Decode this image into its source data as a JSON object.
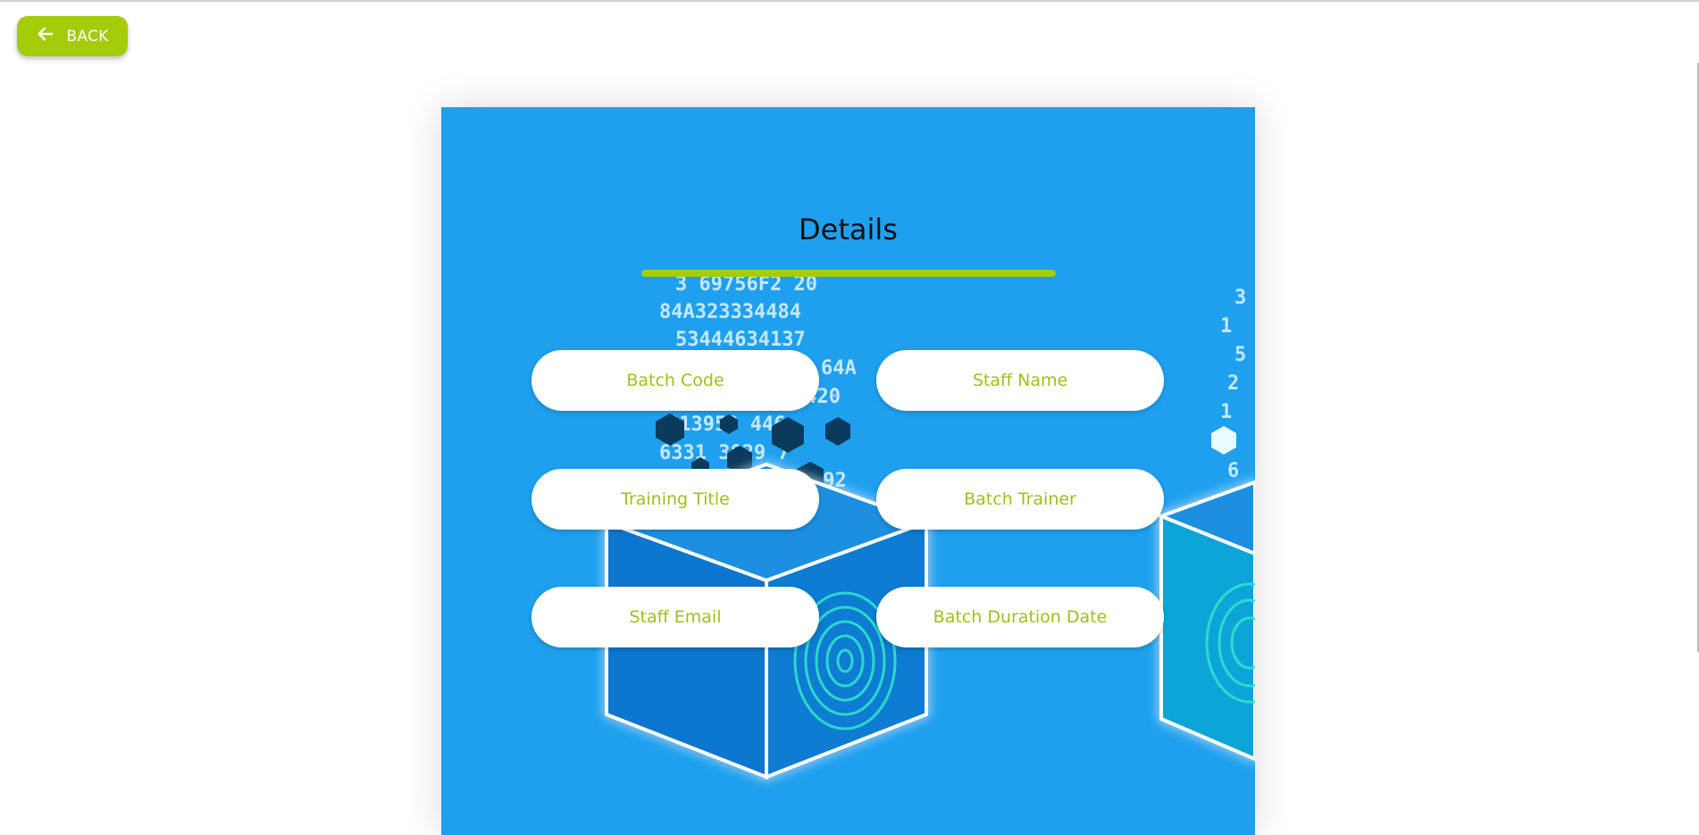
{
  "nav": {
    "back_label": "BACK",
    "back_icon": "arrow-left-icon"
  },
  "panel": {
    "title": "Details",
    "background_art": {
      "description_icons": [
        "hexagon",
        "fingerprint",
        "cube"
      ],
      "digit_rows": [
        "3 69756F2 20",
        "84A323334484",
        "53444634137",
        "64A",
        "4420",
        "013953 446",
        "6331 3829 7",
        "392"
      ],
      "right_digits": [
        "3",
        "1",
        "5",
        "2",
        "1",
        "6"
      ]
    },
    "fields": [
      {
        "id": "batch-code",
        "label": "Batch Code"
      },
      {
        "id": "staff-name",
        "label": "Staff Name"
      },
      {
        "id": "training-title",
        "label": "Training Title"
      },
      {
        "id": "batch-trainer",
        "label": "Batch Trainer"
      },
      {
        "id": "staff-email",
        "label": "Staff Email"
      },
      {
        "id": "batch-duration-date",
        "label": "Batch Duration Date"
      }
    ]
  },
  "colors": {
    "accent": "#a4cc0a",
    "panel_bg": "#1ea0ef",
    "field_text": "#9bc21a",
    "field_bg": "#ffffff"
  }
}
